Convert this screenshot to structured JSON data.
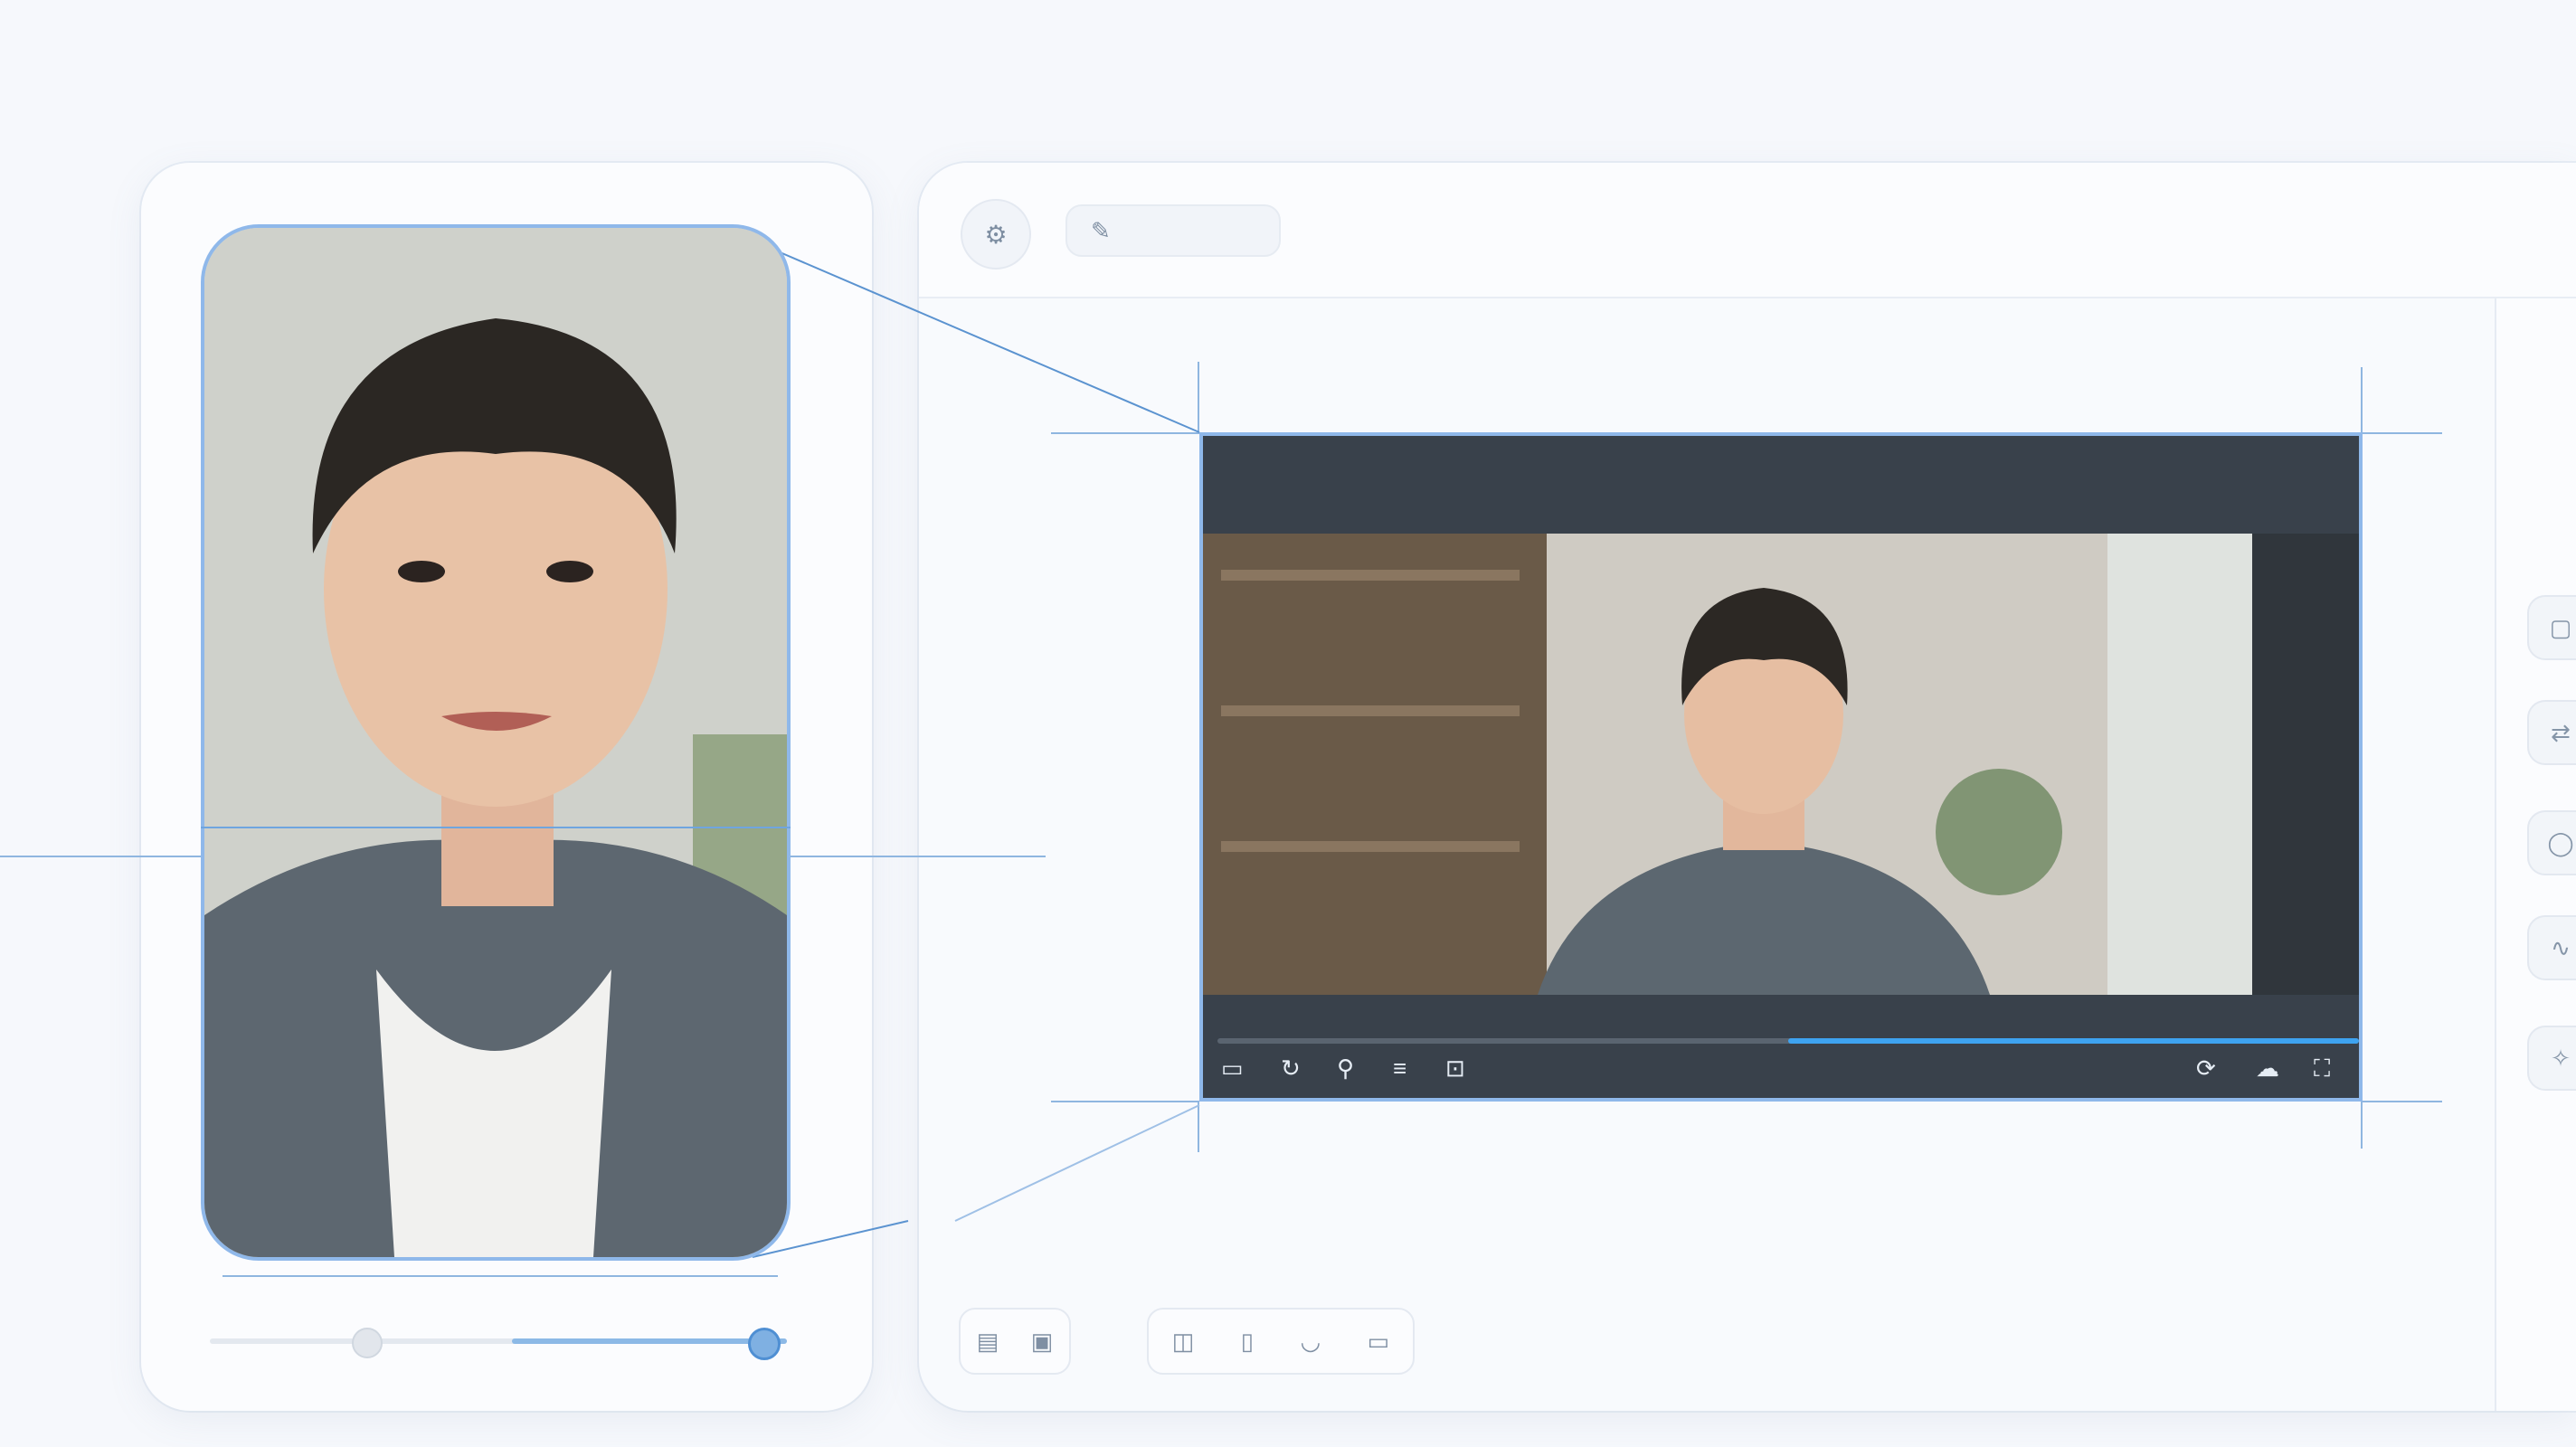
{
  "toolbar": {
    "round_icon": "settings-icon",
    "pill_icon": "pen-icon"
  },
  "rail": {
    "icons": [
      "chat-icon",
      "translate-icon",
      "comment-icon",
      "waveform-icon",
      "sparkle-icon"
    ]
  },
  "player": {
    "progress": 0.5,
    "left_icons": [
      "frame-icon",
      "loop-icon",
      "person-icon",
      "subtitles-icon",
      "caption-icon"
    ],
    "right_icons": [
      "refresh-icon",
      "cloud-icon",
      "fullscreen-icon"
    ]
  },
  "bottom": {
    "group_a": [
      "layout-icon",
      "clipboard-icon"
    ],
    "group_b": [
      "video-crop-icon",
      "page-icon",
      "mask-icon",
      "box-icon"
    ]
  },
  "slider": {
    "thumb_a": 0.27,
    "thumb_b": 0.98
  },
  "colors": {
    "accent": "#3ea3f0",
    "outline": "#8fb8ea",
    "panel": "#39414b"
  }
}
